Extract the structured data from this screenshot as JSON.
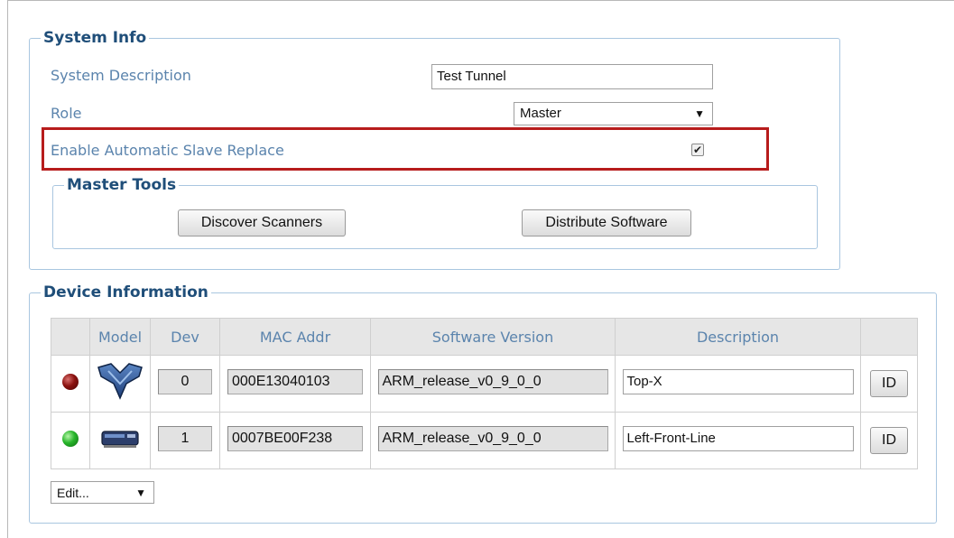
{
  "system_info": {
    "legend": "System Info",
    "description_label": "System Description",
    "description_value": "Test Tunnel",
    "role_label": "Role",
    "role_value": "Master",
    "auto_replace_label": "Enable Automatic Slave Replace",
    "auto_replace_checked": true
  },
  "master_tools": {
    "legend": "Master Tools",
    "discover_label": "Discover Scanners",
    "distribute_label": "Distribute Software"
  },
  "device_info": {
    "legend": "Device Information",
    "columns": [
      "",
      "Model",
      "Dev",
      "MAC Addr",
      "Software Version",
      "Description",
      ""
    ],
    "rows": [
      {
        "status": "red",
        "model_icon": "scanner-x-icon",
        "dev": "0",
        "mac": "000E13040103",
        "software": "ARM_release_v0_9_0_0",
        "description": "Top-X",
        "id_label": "ID"
      },
      {
        "status": "green",
        "model_icon": "scanner-line-icon",
        "dev": "1",
        "mac": "0007BE00F238",
        "software": "ARM_release_v0_9_0_0",
        "description": "Left-Front-Line",
        "id_label": "ID"
      }
    ],
    "edit_select": "Edit..."
  },
  "colors": {
    "legend": "#1f4e79",
    "label": "#5b84ad",
    "highlight": "#b71c1c",
    "border": "#a9c6e0"
  }
}
